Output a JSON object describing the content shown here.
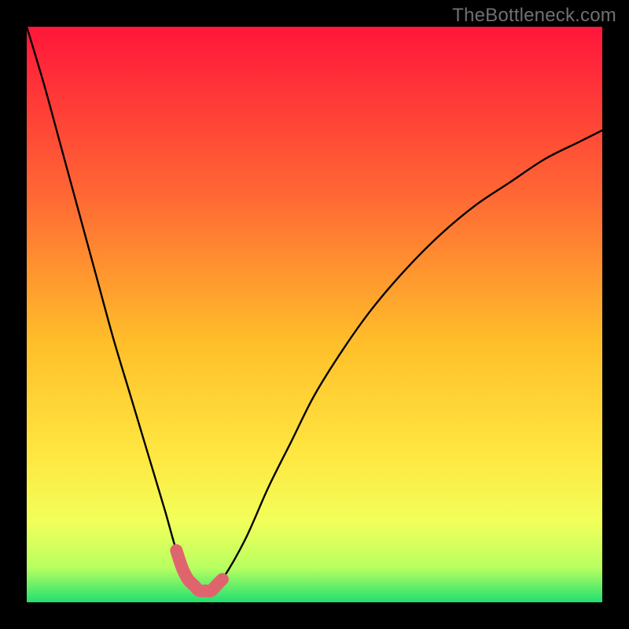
{
  "watermark": "TheBottleneck.com",
  "colors": {
    "page_bg": "#000000",
    "gradient_top": "#ff163a",
    "gradient_mid1": "#ff6a34",
    "gradient_mid2": "#ffbf2a",
    "gradient_mid3": "#ffe640",
    "gradient_mid4": "#f2ff5a",
    "gradient_mid5": "#b8ff60",
    "gradient_bottom": "#20e070",
    "curve_stroke": "#000000",
    "highlight_stroke": "#e0646e"
  },
  "chart_data": {
    "type": "line",
    "title": "",
    "xlabel": "",
    "ylabel": "",
    "xlim": [
      0,
      100
    ],
    "ylim": [
      0,
      100
    ],
    "grid": false,
    "legend": false,
    "annotations": [],
    "series": [
      {
        "name": "bottleneck-curve",
        "x": [
          0,
          3,
          6,
          9,
          12,
          15,
          18,
          21,
          24,
          26,
          28,
          30,
          32,
          34,
          38,
          42,
          46,
          50,
          55,
          60,
          66,
          72,
          78,
          84,
          90,
          96,
          100
        ],
        "y": [
          100,
          90,
          79,
          68,
          57,
          46,
          36,
          26,
          16,
          9,
          4,
          2,
          2,
          4,
          11,
          20,
          28,
          36,
          44,
          51,
          58,
          64,
          69,
          73,
          77,
          80,
          82
        ]
      },
      {
        "name": "optimal-region-highlight",
        "x": [
          26,
          27,
          28,
          29,
          30,
          31,
          32,
          33,
          34
        ],
        "y": [
          9,
          6,
          4,
          3,
          2,
          2,
          2,
          3,
          4
        ]
      }
    ]
  }
}
